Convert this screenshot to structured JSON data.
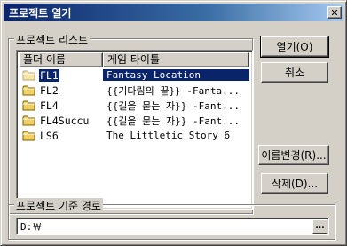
{
  "window": {
    "title": "프로젝트 열기",
    "close_glyph": "✕"
  },
  "project_list": {
    "group_label": "프로젝트 리스트",
    "columns": [
      "폴더 이름",
      "게임 타이틀"
    ],
    "rows": [
      {
        "folder": "FL1",
        "title": "Fantasy Location",
        "selected": true
      },
      {
        "folder": "FL2",
        "title": "{{기다림의 끝}} -Fanta...",
        "selected": false
      },
      {
        "folder": "FL4",
        "title": "{{길을 묻는 자}} -Fant...",
        "selected": false
      },
      {
        "folder": "FL4Succu",
        "title": "{{길을 묻는 자}} -Fant...",
        "selected": false
      },
      {
        "folder": "LS6",
        "title": "The Littletic Story 6",
        "selected": false
      }
    ]
  },
  "buttons": {
    "open": "열기(O)",
    "cancel": "취소",
    "rename": "이름변경(R)...",
    "delete": "삭제(D)..."
  },
  "base_path": {
    "group_label": "프로젝트 기준 경로",
    "value": "D:￦",
    "browse_label": "..."
  },
  "colors": {
    "selection": "#0a246a",
    "folder_yellow": "#f0d060"
  },
  "icons": {
    "folder": "folder-icon",
    "close": "close-icon"
  }
}
